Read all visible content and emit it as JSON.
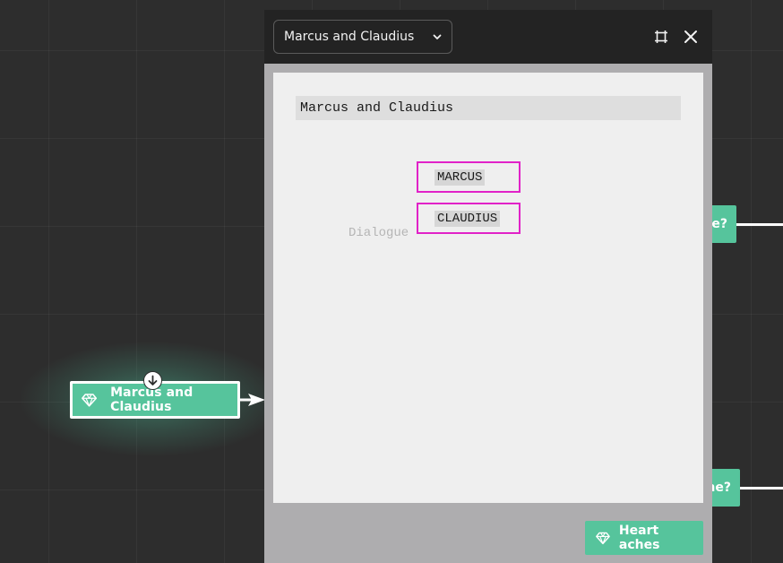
{
  "modal": {
    "selected_passage": "Marcus and Claudius",
    "preview": {
      "title": "Marcus and Claudius",
      "characters": [
        "MARCUS",
        "CLAUDIUS"
      ],
      "placeholder": "Dialogue"
    },
    "footer_button": "Heart aches"
  },
  "canvas": {
    "left_node_label": "Marcus and Claudius",
    "right_node_1_text": "e?",
    "right_node_2_text": "ne?"
  },
  "colors": {
    "node": "#56c49c",
    "highlight": "#e122c8",
    "background": "#2d2d2d"
  },
  "icons": [
    "diamond-icon",
    "arrow-down-icon",
    "chevron-down-icon",
    "expand-icon",
    "close-icon"
  ]
}
